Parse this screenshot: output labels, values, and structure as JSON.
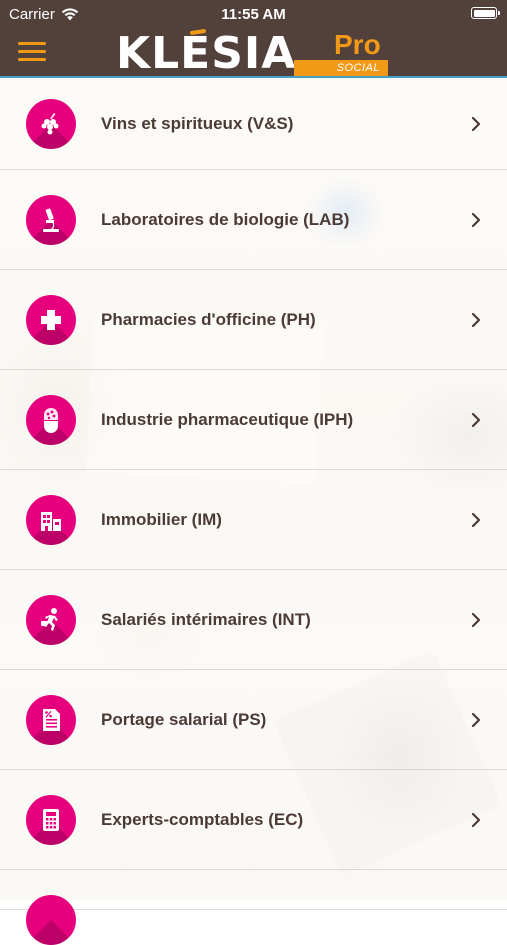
{
  "status_bar": {
    "carrier": "Carrier",
    "time": "11:55 AM"
  },
  "header": {
    "logo_text": "KLESIA",
    "logo_pro": "Pro",
    "logo_social": "SOCIAL",
    "accent_color": "#f29a18",
    "background_color": "#52403b"
  },
  "items": [
    {
      "label": "Vins et spiritueux (V&S)",
      "icon": "grapes-icon"
    },
    {
      "label": "Laboratoires de biologie (LAB)",
      "icon": "microscope-icon"
    },
    {
      "label": "Pharmacies d'officine (PH)",
      "icon": "pharmacy-cross-icon"
    },
    {
      "label": "Industrie pharmaceutique (IPH)",
      "icon": "pill-capsule-icon"
    },
    {
      "label": "Immobilier (IM)",
      "icon": "buildings-icon"
    },
    {
      "label": "Salariés intérimaires (INT)",
      "icon": "running-person-icon"
    },
    {
      "label": "Portage salarial (PS)",
      "icon": "percent-document-icon"
    },
    {
      "label": "Experts-comptables (EC)",
      "icon": "calculator-icon"
    }
  ],
  "icon_color": "#e6007e",
  "text_color": "#4b3a35"
}
